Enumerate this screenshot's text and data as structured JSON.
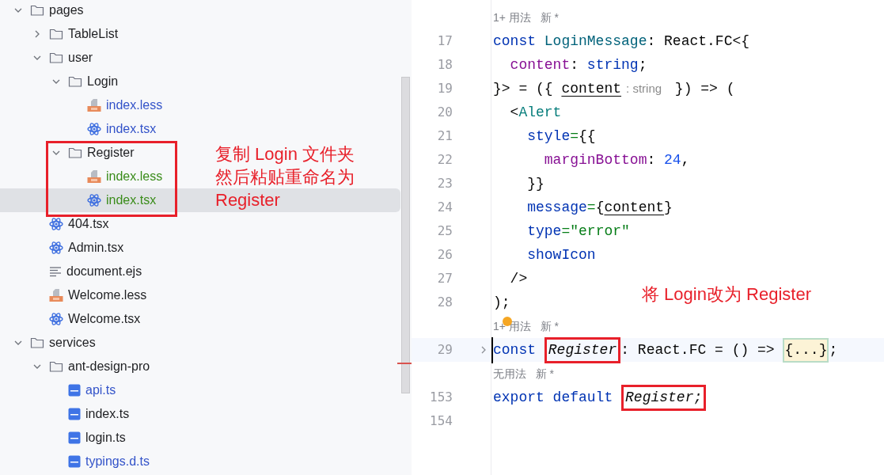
{
  "project_tree": [
    {
      "name": "pages",
      "kind": "folder",
      "expanded": true,
      "selected": false,
      "color": "#1e1f22",
      "children": [
        {
          "name": "TableList",
          "kind": "folder",
          "expanded": false,
          "selected": false,
          "color": "#1e1f22"
        },
        {
          "name": "user",
          "kind": "folder",
          "expanded": true,
          "selected": false,
          "color": "#1e1f22",
          "children": [
            {
              "name": "Login",
              "kind": "folder",
              "expanded": true,
              "selected": false,
              "color": "#1e1f22",
              "children": [
                {
                  "name": "index.less",
                  "kind": "less",
                  "selected": false,
                  "color": "#3353c9"
                },
                {
                  "name": "index.tsx",
                  "kind": "react",
                  "selected": false,
                  "color": "#3353c9"
                }
              ]
            },
            {
              "name": "Register",
              "kind": "folder",
              "expanded": true,
              "selected": false,
              "color": "#1e1f22",
              "children": [
                {
                  "name": "index.less",
                  "kind": "less",
                  "selected": false,
                  "color": "#3a8c1a"
                },
                {
                  "name": "index.tsx",
                  "kind": "react",
                  "selected": true,
                  "color": "#3a8c1a"
                }
              ]
            }
          ]
        },
        {
          "name": "404.tsx",
          "kind": "react",
          "selected": false,
          "color": "#1e1f22"
        },
        {
          "name": "Admin.tsx",
          "kind": "react",
          "selected": false,
          "color": "#1e1f22"
        },
        {
          "name": "document.ejs",
          "kind": "text",
          "selected": false,
          "color": "#1e1f22"
        },
        {
          "name": "Welcome.less",
          "kind": "less",
          "selected": false,
          "color": "#1e1f22"
        },
        {
          "name": "Welcome.tsx",
          "kind": "react",
          "selected": false,
          "color": "#1e1f22"
        }
      ]
    },
    {
      "name": "services",
      "kind": "folder",
      "expanded": true,
      "selected": false,
      "color": "#1e1f22",
      "children": [
        {
          "name": "ant-design-pro",
          "kind": "folder",
          "expanded": true,
          "selected": false,
          "color": "#1e1f22",
          "children": [
            {
              "name": "api.ts",
              "kind": "ts",
              "selected": false,
              "color": "#3353c9"
            },
            {
              "name": "index.ts",
              "kind": "ts",
              "selected": false,
              "color": "#1e1f22"
            },
            {
              "name": "login.ts",
              "kind": "ts",
              "selected": false,
              "color": "#1e1f22"
            },
            {
              "name": "typings.d.ts",
              "kind": "ts",
              "selected": false,
              "color": "#3353c9"
            }
          ]
        }
      ]
    }
  ],
  "tree_note": [
    "复制 Login 文件夹",
    "然后粘贴重命名为",
    "Register"
  ],
  "editor": {
    "lines": [
      {
        "kind": "hint",
        "text": "1+ 用法   新 *"
      },
      {
        "kind": "code",
        "number": "17",
        "current": false,
        "tokens": [
          {
            "kind": "keyword",
            "s": "const "
          },
          {
            "kind": "name",
            "s": "LoginMessage"
          },
          {
            "kind": "plain",
            "s": ": React.FC<{"
          }
        ]
      },
      {
        "kind": "code",
        "number": "18",
        "current": false,
        "tokens": [
          {
            "kind": "prop",
            "s": "  content"
          },
          {
            "kind": "plain",
            "s": ": "
          },
          {
            "kind": "keyword",
            "s": "string"
          },
          {
            "kind": "plain",
            "s": ";"
          }
        ]
      },
      {
        "kind": "code",
        "number": "19",
        "current": false,
        "tokens": [
          {
            "kind": "plain",
            "s": "}> = ({ "
          },
          {
            "kind": "param",
            "s": "content"
          },
          {
            "kind": "inlay",
            "s": ": string"
          },
          {
            "kind": "plain",
            "s": " }) => ("
          }
        ]
      },
      {
        "kind": "code",
        "number": "20",
        "current": false,
        "tokens": [
          {
            "kind": "plain",
            "s": "  <"
          },
          {
            "kind": "tag",
            "s": "Alert"
          }
        ]
      },
      {
        "kind": "code",
        "number": "21",
        "current": false,
        "tokens": [
          {
            "kind": "keyword",
            "s": "    style"
          },
          {
            "kind": "string",
            "s": "="
          },
          {
            "kind": "plain",
            "s": "{{"
          }
        ]
      },
      {
        "kind": "code",
        "number": "22",
        "current": false,
        "tokens": [
          {
            "kind": "prop",
            "s": "      marginBottom"
          },
          {
            "kind": "plain",
            "s": ": "
          },
          {
            "kind": "number",
            "s": "24"
          },
          {
            "kind": "plain",
            "s": ","
          }
        ]
      },
      {
        "kind": "code",
        "number": "23",
        "current": false,
        "tokens": [
          {
            "kind": "plain",
            "s": "    }}"
          }
        ]
      },
      {
        "kind": "code",
        "number": "24",
        "current": false,
        "tokens": [
          {
            "kind": "keyword",
            "s": "    message"
          },
          {
            "kind": "string",
            "s": "="
          },
          {
            "kind": "plain",
            "s": "{"
          },
          {
            "kind": "param",
            "s": "content"
          },
          {
            "kind": "plain",
            "s": "}"
          }
        ]
      },
      {
        "kind": "code",
        "number": "25",
        "current": false,
        "tokens": [
          {
            "kind": "keyword",
            "s": "    type"
          },
          {
            "kind": "string",
            "s": "=\"error\""
          }
        ]
      },
      {
        "kind": "code",
        "number": "26",
        "current": false,
        "tokens": [
          {
            "kind": "keyword",
            "s": "    showIcon"
          }
        ]
      },
      {
        "kind": "code",
        "number": "27",
        "current": false,
        "tokens": [
          {
            "kind": "plain",
            "s": "  />"
          }
        ]
      },
      {
        "kind": "code",
        "number": "28",
        "current": false,
        "tokens": [
          {
            "kind": "plain",
            "s": ");"
          }
        ]
      },
      {
        "kind": "hint",
        "text": "1+ 用法   新 *"
      },
      {
        "kind": "code",
        "number": "29",
        "current": true,
        "folded": true,
        "tokens": [
          {
            "kind": "keyword",
            "s": "const "
          },
          {
            "kind": "italic",
            "s": "Register",
            "boxed": true
          },
          {
            "kind": "plain",
            "s": ": React.FC = () => "
          },
          {
            "kind": "fold",
            "s": "{...}"
          },
          {
            "kind": "plain",
            "s": ";"
          }
        ]
      },
      {
        "kind": "hint",
        "text": "无用法   新 *"
      },
      {
        "kind": "code",
        "number": "153",
        "current": false,
        "tokens": [
          {
            "kind": "keyword",
            "s": "export default "
          },
          {
            "kind": "italic",
            "s": "Register;",
            "boxed": true
          }
        ]
      },
      {
        "kind": "code",
        "number": "154",
        "current": false
      }
    ]
  },
  "editor_note": "将 Login改为 Register"
}
